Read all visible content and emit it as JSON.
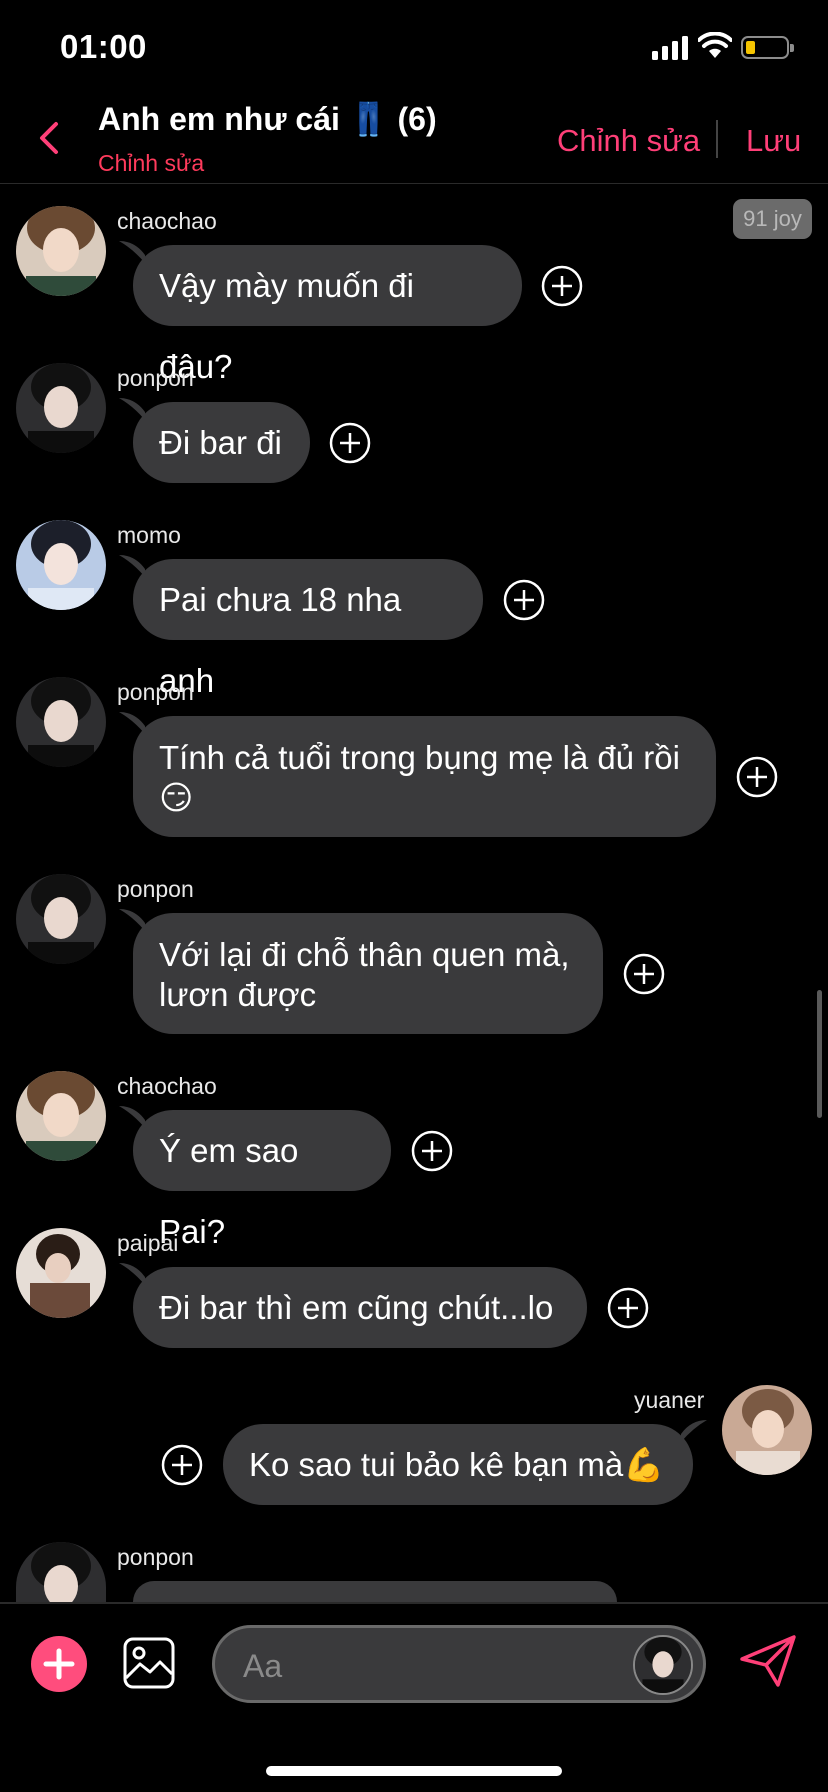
{
  "status_bar": {
    "time": "01:00"
  },
  "header": {
    "title": "Anh em như cái 👖 (6)",
    "subtitle": "Chỉnh sửa",
    "edit_label": "Chỉnh sửa",
    "save_label": "Lưu"
  },
  "badge": "91 joy",
  "messages": [
    {
      "sender": "chaochao",
      "text": "Vậy mày muốn đi đâu?"
    },
    {
      "sender": "ponpon",
      "text": "Đi bar đi"
    },
    {
      "sender": "momo",
      "text": "Pai chưa 18 nha anh"
    },
    {
      "sender": "ponpon",
      "text_line1": "Tính cả tuổi trong bụng mẹ là đủ rồi",
      "text_line2": "😏"
    },
    {
      "sender": "ponpon",
      "text_line1": "Với lại đi chỗ thân quen mà,",
      "text_line2": "lươn được"
    },
    {
      "sender": "chaochao",
      "text": "Ý em sao Pai?"
    },
    {
      "sender": "paipai",
      "text": "Đi bar thì em cũng chút...lo"
    },
    {
      "sender": "yuaner",
      "text": "Ko sao tui bảo kê bạn mà💪"
    },
    {
      "sender": "ponpon"
    }
  ],
  "composer": {
    "placeholder": "Aa"
  },
  "colors": {
    "accent": "#ff3f78",
    "bubble": "#3a3a3c",
    "background": "#000000"
  }
}
